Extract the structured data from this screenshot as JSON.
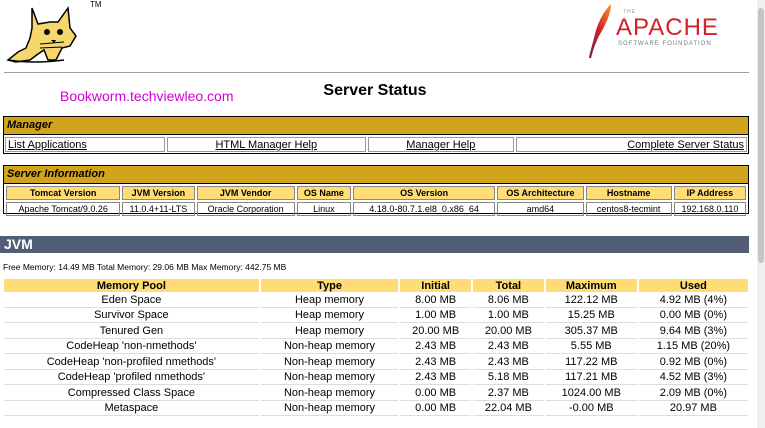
{
  "header": {
    "tomcat_tm": "TM",
    "apache_the": "THE",
    "apache_word": "APACHE",
    "apache_sub": "SOFTWARE FOUNDATION",
    "watermark": "Bookworm.techviewleo.com",
    "title": "Server Status"
  },
  "manager": {
    "heading": "Manager",
    "links": [
      "List Applications",
      "HTML Manager Help",
      "Manager Help",
      "Complete Server Status"
    ]
  },
  "server_info": {
    "heading": "Server Information",
    "columns": [
      "Tomcat Version",
      "JVM Version",
      "JVM Vendor",
      "OS Name",
      "OS Version",
      "OS Architecture",
      "Hostname",
      "IP Address"
    ],
    "values": [
      "Apache Tomcat/9.0.26",
      "11.0.4+11-LTS",
      "Oracle Corporation",
      "Linux",
      "4.18.0-80.7.1.el8_0.x86_64",
      "amd64",
      "centos8-tecmint",
      "192.168.0.110"
    ]
  },
  "jvm": {
    "heading": "JVM",
    "memory_line": "Free Memory: 14.49 MB Total Memory: 29.06 MB Max Memory: 442.75 MB",
    "columns": [
      "Memory Pool",
      "Type",
      "Initial",
      "Total",
      "Maximum",
      "Used"
    ],
    "rows": [
      [
        "Eden Space",
        "Heap memory",
        "8.00 MB",
        "8.06 MB",
        "122.12 MB",
        "4.92 MB (4%)"
      ],
      [
        "Survivor Space",
        "Heap memory",
        "1.00 MB",
        "1.00 MB",
        "15.25 MB",
        "0.00 MB (0%)"
      ],
      [
        "Tenured Gen",
        "Heap memory",
        "20.00 MB",
        "20.00 MB",
        "305.37 MB",
        "9.64 MB (3%)"
      ],
      [
        "CodeHeap 'non-nmethods'",
        "Non-heap memory",
        "2.43 MB",
        "2.43 MB",
        "5.55 MB",
        "1.15 MB (20%)"
      ],
      [
        "CodeHeap 'non-profiled nmethods'",
        "Non-heap memory",
        "2.43 MB",
        "2.43 MB",
        "117.22 MB",
        "0.92 MB (0%)"
      ],
      [
        "CodeHeap 'profiled nmethods'",
        "Non-heap memory",
        "2.43 MB",
        "5.18 MB",
        "117.21 MB",
        "4.52 MB (3%)"
      ],
      [
        "Compressed Class Space",
        "Non-heap memory",
        "0.00 MB",
        "2.37 MB",
        "1024.00 MB",
        "2.09 MB (0%)"
      ],
      [
        "Metaspace",
        "Non-heap memory",
        "0.00 MB",
        "22.04 MB",
        "-0.00 MB",
        "20.97 MB"
      ]
    ]
  },
  "colors": {
    "panel_header": "#d2a41c",
    "table_header": "#ffdc75",
    "jvm_bar": "#525d76",
    "apache_red": "#d22128",
    "watermark": "#d400d4"
  }
}
